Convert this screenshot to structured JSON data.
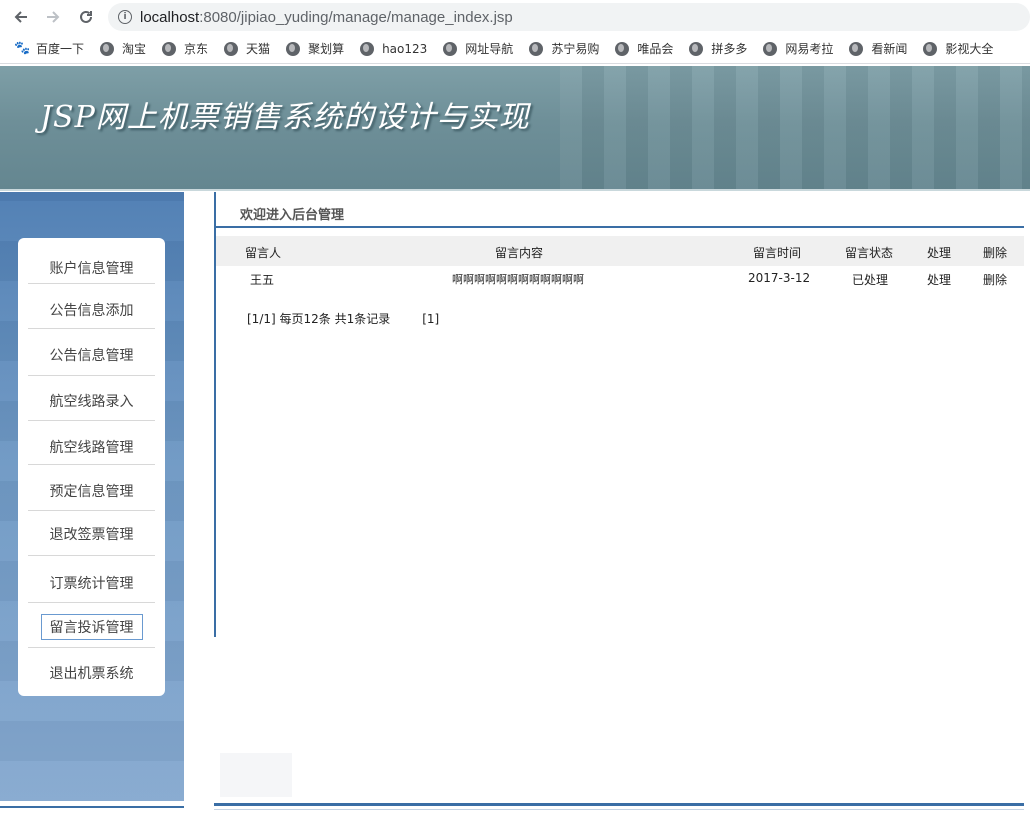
{
  "browser": {
    "url_host": "localhost",
    "url_path": ":8080/jipiao_yuding/manage/manage_index.jsp",
    "bookmarks": [
      "百度一下",
      "淘宝",
      "京东",
      "天猫",
      "聚划算",
      "hao123",
      "网址导航",
      "苏宁易购",
      "唯品会",
      "拼多多",
      "网易考拉",
      "看新闻",
      "影视大全"
    ]
  },
  "header": {
    "title": "JSP网上机票销售系统的设计与实现"
  },
  "sidebar": {
    "items": [
      {
        "label": "账户信息管理"
      },
      {
        "label": "公告信息添加"
      },
      {
        "label": "公告信息管理"
      },
      {
        "label": "航空线路录入"
      },
      {
        "label": "航空线路管理"
      },
      {
        "label": "预定信息管理"
      },
      {
        "label": "退改签票管理"
      },
      {
        "label": "订票统计管理"
      },
      {
        "label": "留言投诉管理"
      },
      {
        "label": "退出机票系统"
      }
    ],
    "active_item": "留言投诉管理"
  },
  "main": {
    "welcome": "欢迎进入后台管理",
    "table": {
      "columns": [
        "留言人",
        "留言内容",
        "留言时间",
        "留言状态",
        "处理",
        "删除"
      ],
      "rows": [
        {
          "author": "王五",
          "content": "啊啊啊啊啊啊啊啊啊啊啊啊",
          "time": "2017-3-12",
          "status": "已处理",
          "handle": "处理",
          "delete": "删除"
        }
      ]
    },
    "pager": {
      "summary": "[1/1] 每页12条 共1条记录",
      "page_link": "[1]"
    }
  }
}
